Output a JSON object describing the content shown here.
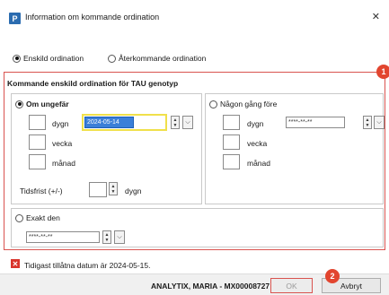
{
  "window": {
    "icon_letter": "P",
    "title": "Information om kommande ordination",
    "close_glyph": "✕"
  },
  "ordination_type": {
    "options": [
      {
        "label": "Enskild ordination",
        "checked": true
      },
      {
        "label": "Återkommande ordination",
        "checked": false
      }
    ]
  },
  "panel": {
    "header": "Kommande enskild ordination för TAU genotyp",
    "badge": "1"
  },
  "about": {
    "radio_label": "Om ungefär",
    "checked": true,
    "rows": [
      {
        "unit": "dygn"
      },
      {
        "unit": "vecka"
      },
      {
        "unit": "månad"
      }
    ],
    "date_value": "2024-05-14",
    "tolerance_label": "Tidsfrist (+/-)",
    "tolerance_unit": "dygn"
  },
  "before": {
    "radio_label": "Någon gång före",
    "checked": false,
    "rows": [
      {
        "unit": "dygn"
      },
      {
        "unit": "vecka"
      },
      {
        "unit": "månad"
      }
    ],
    "date_placeholder": "****-**-**"
  },
  "exact": {
    "radio_label": "Exakt den",
    "checked": false,
    "date_placeholder": "****-**-**"
  },
  "message": {
    "icon_glyph": "✕",
    "text": "Tidigast tillåtna datum är 2024-05-15."
  },
  "footer": {
    "user": "ANALYTIX, MARIA - MX00008727",
    "ok_label": "OK",
    "cancel_label": "Avbryt",
    "badge": "2"
  },
  "icons": {
    "spin_up": "▲",
    "spin_down": "▼",
    "dropdown": "⌵"
  },
  "colors": {
    "accent_red": "#d9534f",
    "badge": "#e2452f",
    "selection": "#3b7fd8",
    "highlight_outline": "#f0e04a"
  }
}
